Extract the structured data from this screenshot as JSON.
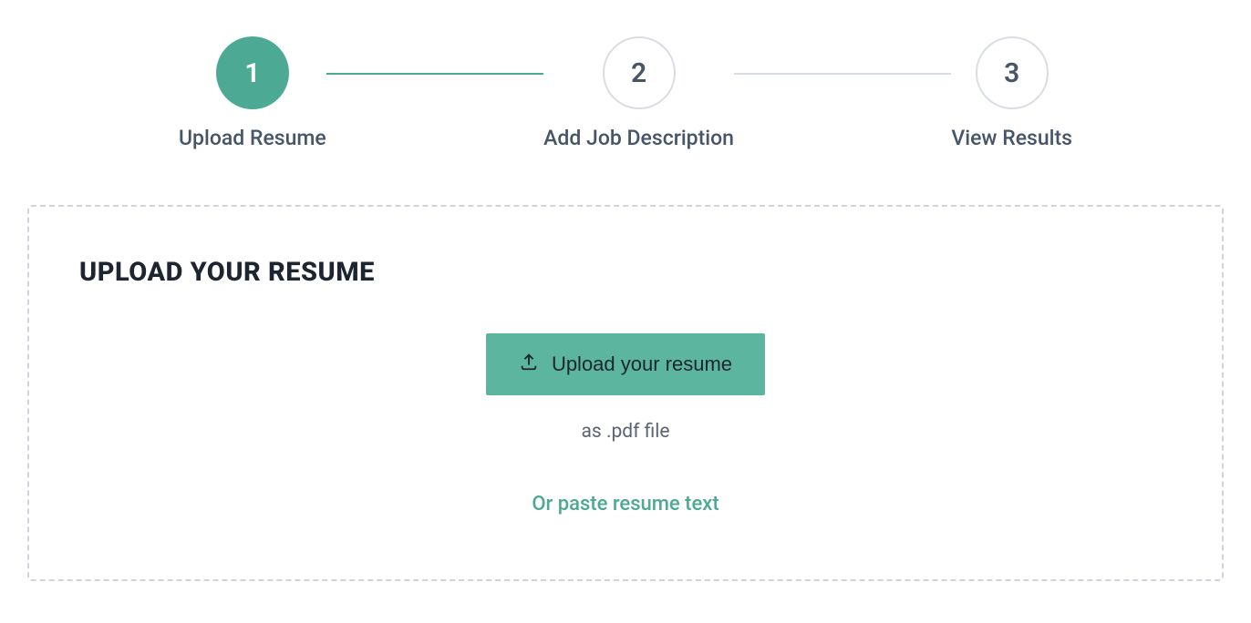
{
  "stepper": {
    "steps": [
      {
        "number": "1",
        "label": "Upload Resume",
        "state": "active"
      },
      {
        "number": "2",
        "label": "Add Job Description",
        "state": "inactive"
      },
      {
        "number": "3",
        "label": "View Results",
        "state": "inactive"
      }
    ]
  },
  "panel": {
    "title": "UPLOAD YOUR RESUME",
    "upload_button_label": "Upload your resume",
    "file_hint": "as .pdf file",
    "paste_link_label": "Or paste resume text"
  },
  "colors": {
    "accent": "#4ca993",
    "button_bg": "#5cb59e",
    "text_muted": "#5b6472",
    "border_dashed": "#cfd4da"
  }
}
